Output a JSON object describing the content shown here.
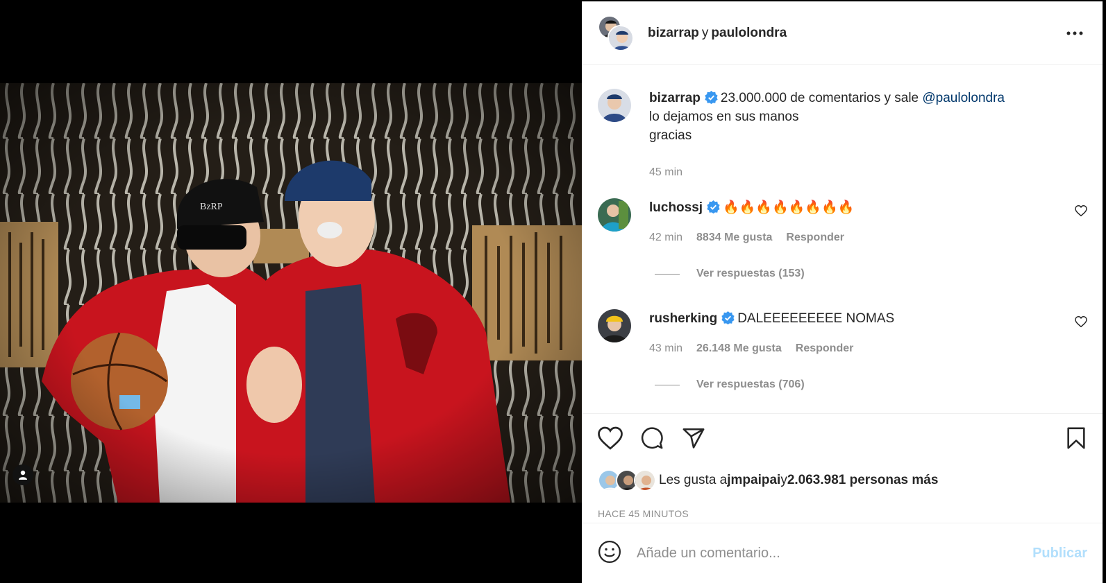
{
  "header": {
    "user1": "bizarrap",
    "conjunction": "y",
    "user2": "paulolondra"
  },
  "caption": {
    "username": "bizarrap",
    "text_pre": "23.000.000 de comentarios y sale ",
    "mention": "@paulolondra",
    "line2": "lo dejamos en sus manos",
    "line3": "gracias",
    "time": "45 min"
  },
  "comments": [
    {
      "username": "luchossj",
      "text": "🔥🔥🔥🔥🔥🔥🔥🔥",
      "time": "42 min",
      "likes": "8834 Me gusta",
      "reply": "Responder",
      "view_replies": "Ver respuestas (153)"
    },
    {
      "username": "rusherking",
      "text": "DALEEEEEEEEE NOMAS",
      "time": "43 min",
      "likes": "26.148 Me gusta",
      "reply": "Responder",
      "view_replies": "Ver respuestas (706)"
    }
  ],
  "likes": {
    "prefix": "Les gusta a ",
    "user": "jmpaipai",
    "conj": " y ",
    "count": "2.063.981 personas más"
  },
  "timestamp": "HACE 45 MINUTOS",
  "add_comment": {
    "placeholder": "Añade un comentario...",
    "publish": "Publicar"
  },
  "colors": {
    "verified": "#3897f0",
    "mention": "#00376b",
    "publish_disabled": "#b2dffc",
    "jacket_red": "#c8141e"
  },
  "icons": [
    "more-options-icon",
    "verified-badge-icon",
    "heart-icon",
    "comment-icon",
    "share-icon",
    "bookmark-icon",
    "emoji-icon",
    "user-tag-icon"
  ]
}
